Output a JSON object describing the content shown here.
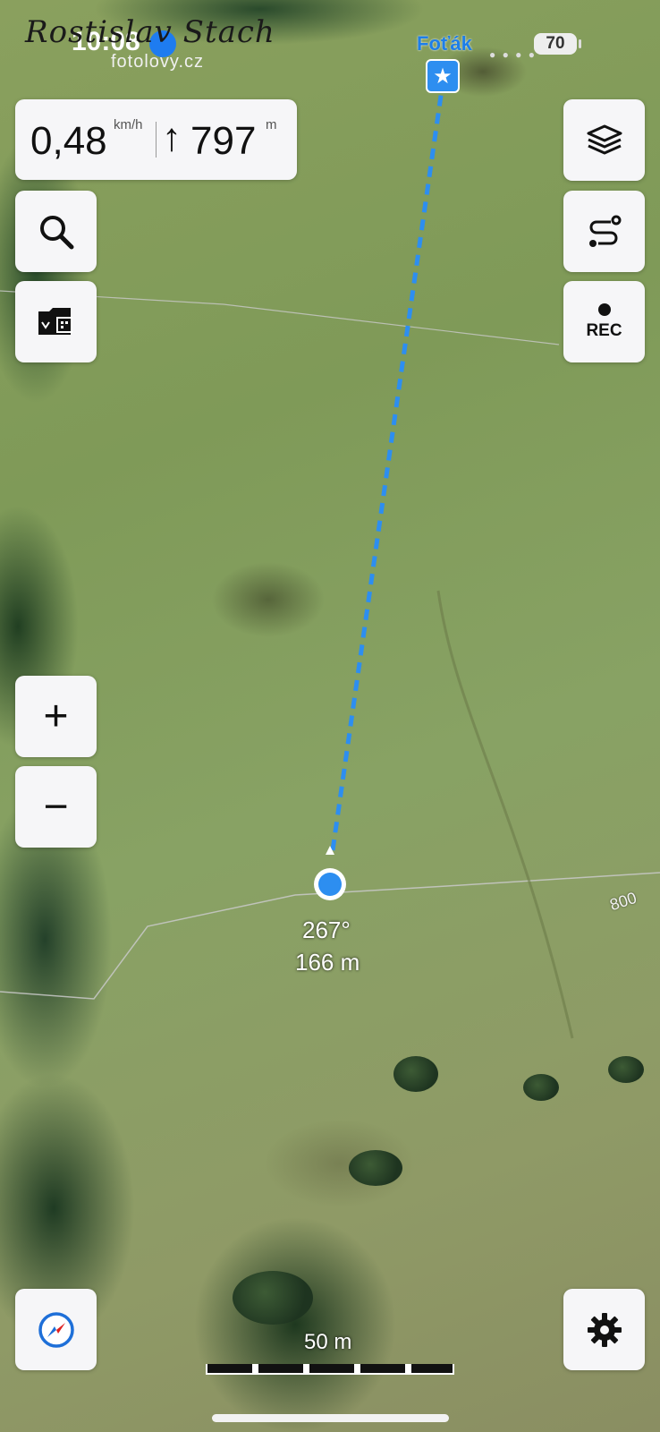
{
  "status_bar": {
    "time": "10:08",
    "battery": "70"
  },
  "watermark": {
    "signature": "Rostislav Stach",
    "site": "fotolovy.cz"
  },
  "speed_panel": {
    "speed": "0,48",
    "speed_unit": "km/h",
    "altitude_arrow": "↑",
    "altitude": "797",
    "altitude_unit": "m"
  },
  "waypoint": {
    "name": "Foťák",
    "icon": "star-icon"
  },
  "left_controls": {
    "search_icon": "search-icon",
    "folder_icon": "folder-map-icon",
    "zoom_in": "+",
    "zoom_out": "−",
    "compass_icon": "compass-icon"
  },
  "right_controls": {
    "layers_icon": "layers-icon",
    "route_icon": "route-icon",
    "rec_label": "REC",
    "settings_icon": "gear-icon"
  },
  "position": {
    "heading": "267°",
    "distance": "166 m"
  },
  "map": {
    "contour_label": "800",
    "scale_label": "50 m",
    "accent_color": "#2d8ef0"
  }
}
